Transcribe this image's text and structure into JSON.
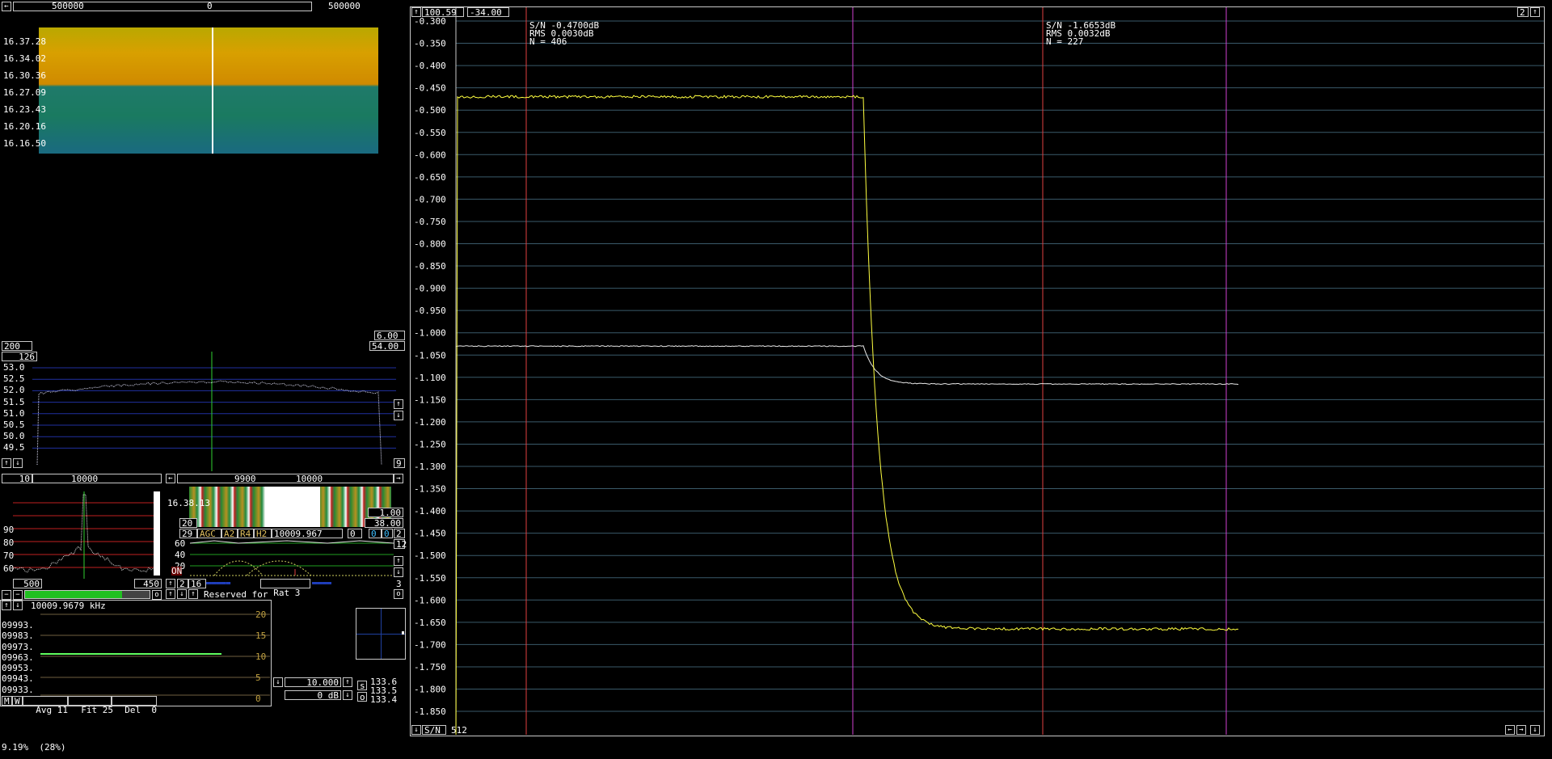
{
  "waterfall": {
    "freq_left": "500000",
    "freq_center": "0",
    "freq_right": "500000",
    "times": [
      "16.37.28",
      "16.34.02",
      "16.30.36",
      "16.27.09",
      "16.23.43",
      "16.20.16",
      "16.16.50"
    ],
    "field_left": "200",
    "field_right_top": "6.00",
    "field_right_bottom": "54.00"
  },
  "spectrum": {
    "field_top": "126",
    "yticks": [
      "53.0",
      "52.5",
      "52.0",
      "51.5",
      "51.0",
      "50.5",
      "50.0",
      "49.5"
    ],
    "field_right": "9"
  },
  "baseband": {
    "field_left": "10",
    "freq": "10000",
    "yticks": [
      "90",
      "80",
      "70",
      "60"
    ],
    "field_bottom_left": "500",
    "field_bottom_right": "450"
  },
  "hires": {
    "freq1": "9900",
    "freq2": "10000",
    "time": "16.38.13",
    "field_left": "20",
    "field_right1": "1.00",
    "field_right2": "38.00",
    "row_left": "29",
    "buttons": [
      "AGC",
      "A2",
      "R4",
      "H2"
    ],
    "frequency": "10009.967",
    "field_a": "0",
    "field_b": "0",
    "field_c": "0",
    "field_d": "2",
    "yticks": [
      "60",
      "40",
      "20"
    ],
    "field_12": "12",
    "on_label": "ON",
    "btn_2": "2",
    "btn_16": "16",
    "rat_label": "Rat",
    "rat_value": "3",
    "right_3": "3",
    "reserved_text": "Reserved for"
  },
  "freqlist": {
    "header": "10009.9679 kHz",
    "rows": [
      "09993.",
      "09983.",
      "09973.",
      "09963.",
      "09953.",
      "09943.",
      "09933."
    ],
    "scale": [
      "20",
      "15",
      "10",
      "5",
      "0"
    ],
    "buttons": {
      "m": "M",
      "w": "W"
    },
    "avg_label": "Avg",
    "avg_value": "11",
    "fit_label": "Fit",
    "fit_value": "25",
    "del_label": "Del",
    "del_value": "0",
    "value1": "10.000",
    "value2": "0 dB",
    "readouts": [
      "133.6",
      "133.5",
      "133.4"
    ],
    "btn_s": "s",
    "btn_o": "o"
  },
  "main": {
    "field_x": "100.59",
    "field_y": "-34.00",
    "field_page": "2",
    "yticks": [
      "-0.300",
      "-0.350",
      "-0.400",
      "-0.450",
      "-0.500",
      "-0.550",
      "-0.600",
      "-0.650",
      "-0.700",
      "-0.750",
      "-0.800",
      "-0.850",
      "-0.900",
      "-0.950",
      "-1.000",
      "-1.050",
      "-1.100",
      "-1.150",
      "-1.200",
      "-1.250",
      "-1.300",
      "-1.350",
      "-1.400",
      "-1.450",
      "-1.500",
      "-1.550",
      "-1.600",
      "-1.650",
      "-1.700",
      "-1.750",
      "-1.800",
      "-1.850"
    ],
    "marker1": {
      "sn": "S/N -0.4700dB",
      "rms": "RMS 0.0030dB",
      "n": "N = 406"
    },
    "marker2": {
      "sn": "S/N -1.6653dB",
      "rms": "RMS 0.0032dB",
      "n": "N = 227"
    },
    "bottom_mode": "S/N",
    "bottom_value": "512",
    "colors": {
      "yellow": "#ffff40",
      "white": "#e8e8e8",
      "red": "#e04040",
      "magenta": "#d040d0",
      "grid": "#3a5a6a"
    }
  },
  "status": {
    "text": "9.19%  (28%)"
  }
}
